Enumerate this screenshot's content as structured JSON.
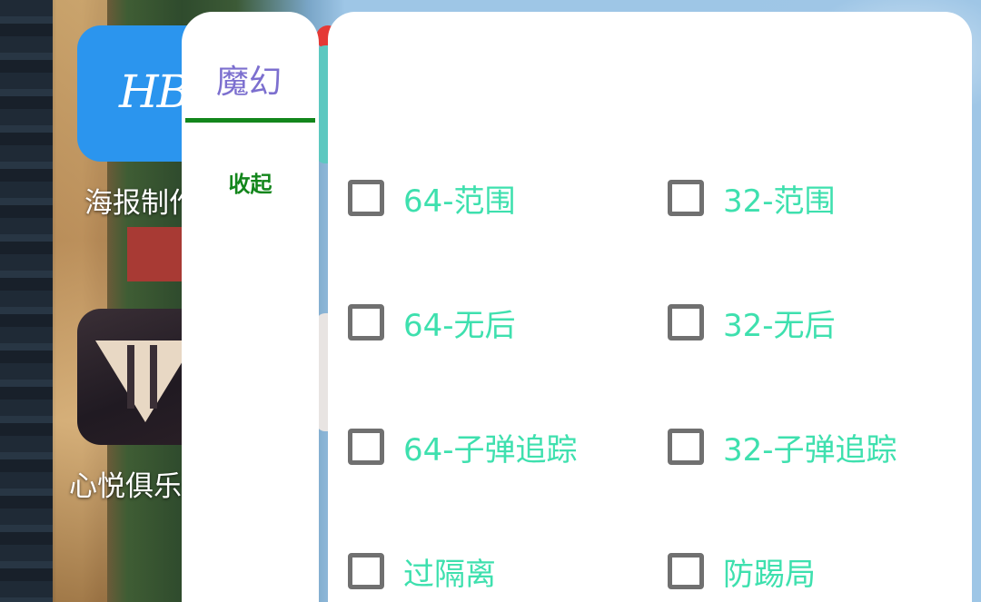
{
  "home_screen": {
    "apps": [
      {
        "icon_text": "HB",
        "label": "海报制作"
      },
      {
        "label": "心悦俱乐"
      }
    ]
  },
  "sidebar": {
    "tab_label": "魔幻",
    "collapse_label": "收起",
    "colors": {
      "tab_text": "#7c6fcf",
      "accent": "#13861c"
    }
  },
  "options": {
    "label_color": "#3ee0ae",
    "items": [
      {
        "label": "64-范围",
        "checked": false
      },
      {
        "label": "32-范围",
        "checked": false
      },
      {
        "label": "64-无后",
        "checked": false
      },
      {
        "label": "32-无后",
        "checked": false
      },
      {
        "label": "64-子弹追踪",
        "checked": false
      },
      {
        "label": "32-子弹追踪",
        "checked": false
      },
      {
        "label": "过隔离",
        "checked": false
      },
      {
        "label": "防踢局",
        "checked": false
      }
    ]
  }
}
